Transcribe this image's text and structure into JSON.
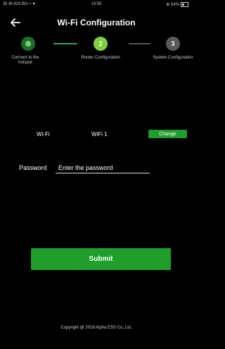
{
  "status_bar": {
    "left": "3il 3il 623 B/s ≈ ♥",
    "time": "14:55",
    "battery": "⊕ 54%"
  },
  "header": {
    "title": "Wi-Fi Configuration",
    "back_icon": "arrow-left-icon"
  },
  "steps": [
    {
      "number": "",
      "label": "Connect to the hotspot",
      "state": "done"
    },
    {
      "number": "2",
      "label": "Router Configuration",
      "state": "active"
    },
    {
      "number": "3",
      "label": "System Configuration",
      "state": "pending"
    }
  ],
  "wifi": {
    "label": "Wi-Fi",
    "value": "WiFi 1",
    "change_label": "Change"
  },
  "password": {
    "label": "Password",
    "placeholder": "Enter the password",
    "value": ""
  },
  "submit_label": "Submit",
  "footer": "Copyright @ 2018 Alpha ESS Co.,Ltd.",
  "colors": {
    "accent": "#1f9e2c",
    "active_step": "#7ed13a",
    "background": "#000000"
  }
}
